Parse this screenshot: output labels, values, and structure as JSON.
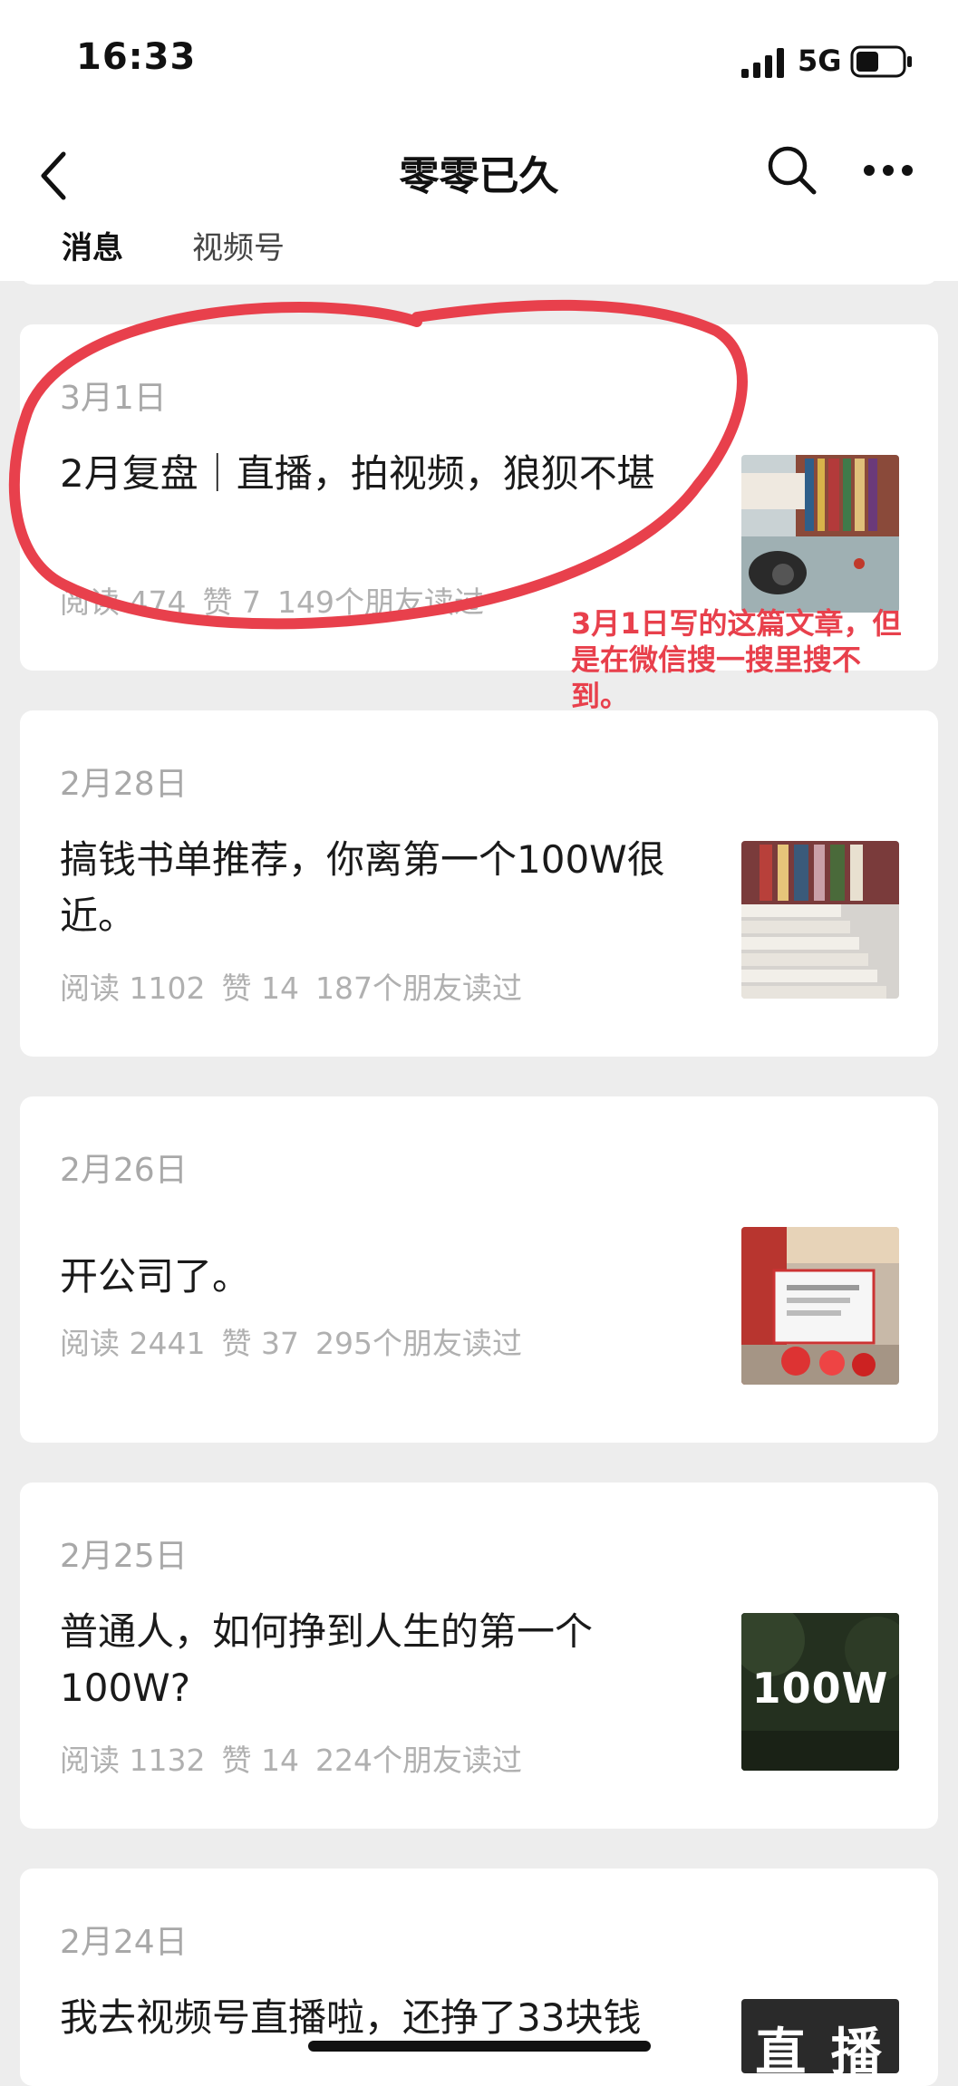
{
  "status_bar": {
    "time": "16:33",
    "network": "5G"
  },
  "nav": {
    "title": "零零已久"
  },
  "tabs": [
    {
      "label": "消息"
    },
    {
      "label": "视频号"
    }
  ],
  "articles": [
    {
      "date": "3月1日",
      "title": "2月复盘｜直播，拍视频，狼狈不堪",
      "reads": "阅读 474",
      "likes": "赞 7",
      "friends": "149个朋友读过"
    },
    {
      "date": "2月28日",
      "title": "搞钱书单推荐，你离第一个100W很近。",
      "reads": "阅读 1102",
      "likes": "赞 14",
      "friends": "187个朋友读过"
    },
    {
      "date": "2月26日",
      "title": "开公司了。",
      "reads": "阅读 2441",
      "likes": "赞 37",
      "friends": "295个朋友读过"
    },
    {
      "date": "2月25日",
      "title": "普通人，如何挣到人生的第一个100W?",
      "reads": "阅读 1132",
      "likes": "赞 14",
      "friends": "224个朋友读过",
      "thumb_text": "100W"
    },
    {
      "date": "2月24日",
      "title": "我去视频号直播啦，还挣了33块钱",
      "thumb_text": "直 播"
    }
  ],
  "annotation": {
    "text": "3月1日写的这篇文章，但是在微信搜一搜里搜不到。",
    "color": "#e8404c"
  },
  "colors": {
    "background": "#ededed",
    "card": "#ffffff",
    "meta_text": "#b0b0b0"
  }
}
